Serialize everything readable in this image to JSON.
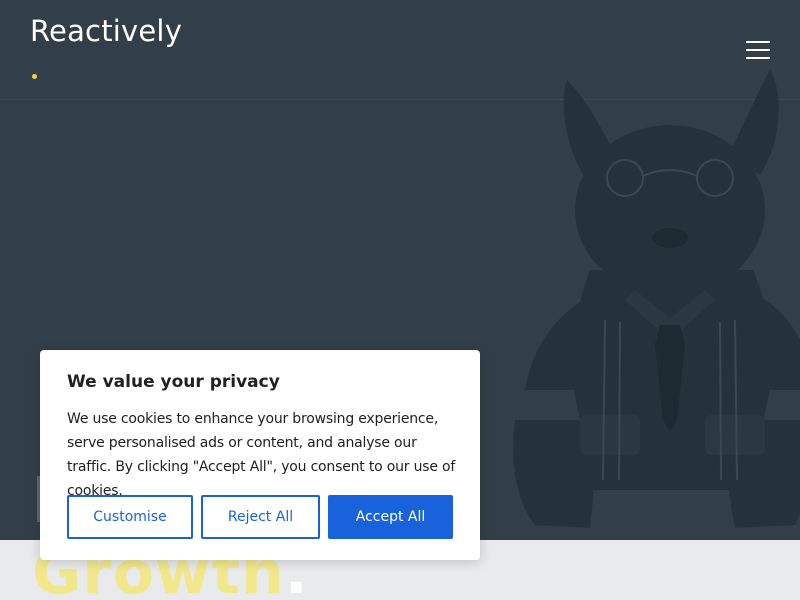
{
  "brand": {
    "name": "Reactively",
    "accent_color": "#f2d33b"
  },
  "header": {
    "menu_icon": "hamburger-menu-icon"
  },
  "hero": {
    "background_color": "#333f48",
    "illustration": "french-bulldog-in-suit",
    "headline_word": "Growth",
    "headline_dot": "."
  },
  "cookie_banner": {
    "title": "We value your privacy",
    "body": "We use cookies to enhance your browsing experience, serve personalised ads or content, and analyse our traffic. By clicking \"Accept All\", you consent to our use of cookies.",
    "buttons": {
      "customise": "Customise",
      "reject": "Reject All",
      "accept": "Accept All"
    },
    "button_color": "#1863dc"
  }
}
